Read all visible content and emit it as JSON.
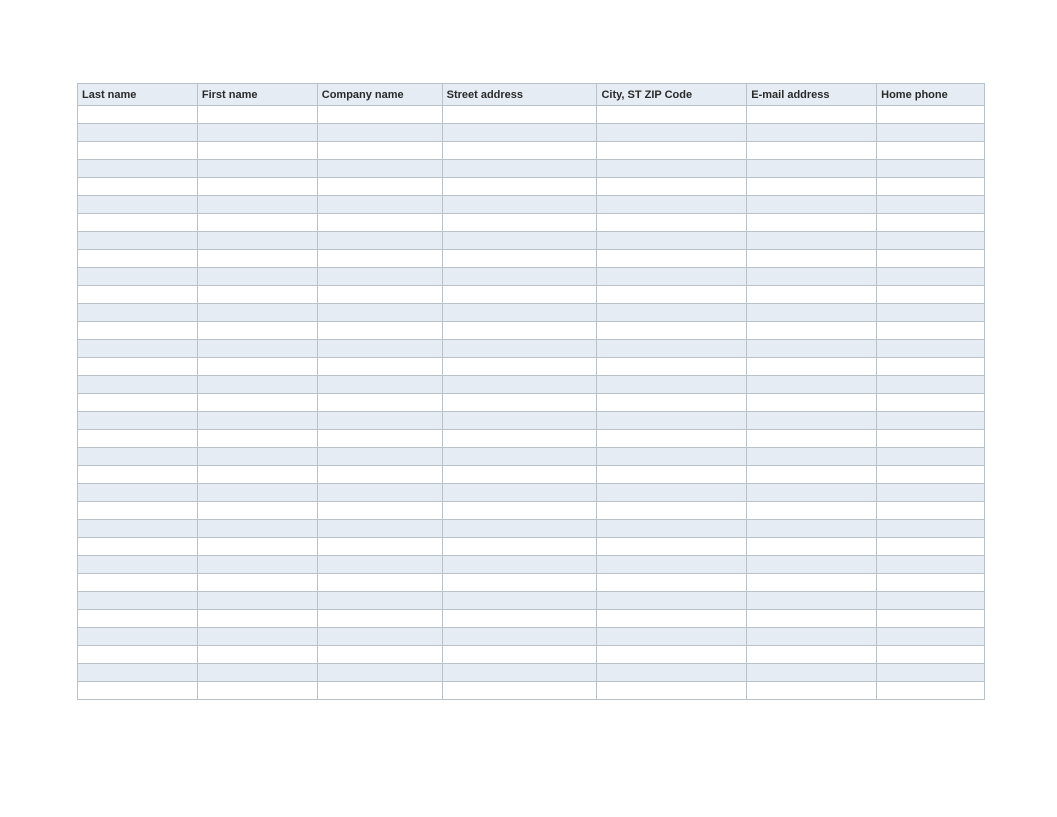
{
  "table": {
    "headers": [
      "Last name",
      "First name",
      "Company name",
      "Street address",
      "City, ST  ZIP Code",
      "E-mail address",
      "Home phone"
    ],
    "row_count": 33
  }
}
